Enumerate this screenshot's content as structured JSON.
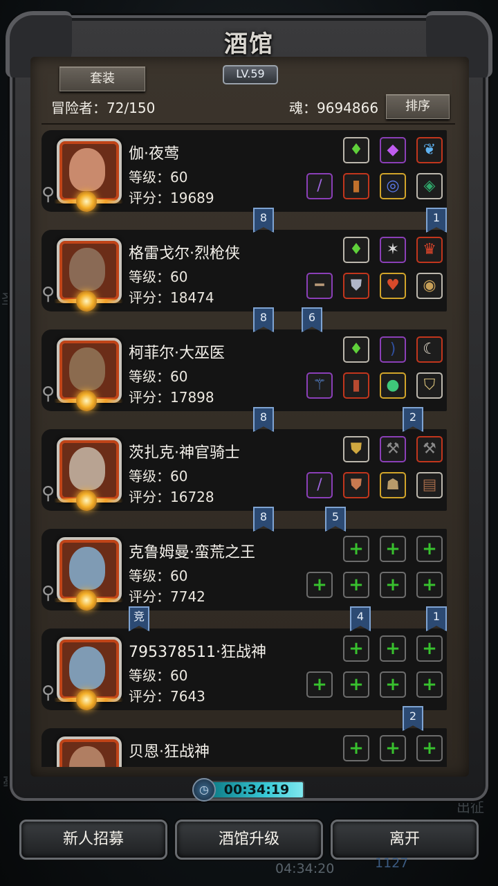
{
  "title": "酒馆",
  "level": "LV.59",
  "suit_button": "套装",
  "sort_button": "排序",
  "adventurers": "冒险者：72/150",
  "soul": "魂：9694866",
  "heroes": [
    {
      "name": "伽·夜莺",
      "level": "等级：60",
      "score": "评分：19689",
      "top": [
        "green-gem-icon",
        "purple-crystal-icon",
        "blue-feather-icon"
      ],
      "bottom": [
        "purple-staff-icon",
        "red-robe-icon",
        "blue-ring-icon",
        "gold-amulet-icon"
      ]
    },
    {
      "name": "格雷戈尔·烈枪侠",
      "level": "等级：60",
      "score": "评分：18474",
      "top": [
        "green-gem-icon",
        "wing-emblem-icon",
        "red-crest-icon"
      ],
      "bottom": [
        "rifle-icon",
        "armor-icon",
        "heart-amulet-icon",
        "round-shield-icon"
      ]
    },
    {
      "name": "柯菲尔·大巫医",
      "level": "等级：60",
      "score": "评分：17898",
      "top": [
        "green-gem-icon",
        "dark-bow-icon",
        "tusk-icon"
      ],
      "bottom": [
        "scepter-icon",
        "red-armor-icon",
        "green-orb-icon",
        "gold-shield-icon"
      ]
    },
    {
      "name": "茨扎克·神官骑士",
      "level": "等级：60",
      "score": "评分：16728",
      "top": [
        "gold-armor-icon",
        "dark-axe-icon",
        "dark-axe-icon"
      ],
      "bottom": [
        "purple-staff-icon",
        "plate-armor-icon",
        "mask-icon",
        "tome-icon"
      ]
    },
    {
      "name": "克鲁姆曼·蛮荒之王",
      "level": "等级：60",
      "score": "评分：7742",
      "top": [
        "empty-slot-icon",
        "empty-slot-icon",
        "empty-slot-icon"
      ],
      "bottom": [
        "empty-slot-icon",
        "empty-slot-icon",
        "empty-slot-icon",
        "empty-slot-icon"
      ]
    },
    {
      "name": "795378511·狂战神",
      "level": "等级：60",
      "score": "评分：7643",
      "top": [
        "empty-slot-icon",
        "empty-slot-icon",
        "empty-slot-icon"
      ],
      "bottom": [
        "empty-slot-icon",
        "empty-slot-icon",
        "empty-slot-icon",
        "empty-slot-icon"
      ]
    },
    {
      "name": "贝恩·狂战神",
      "level": "",
      "score": "",
      "top": [
        "empty-slot-icon",
        "empty-slot-icon",
        "empty-slot-icon"
      ],
      "bottom": []
    }
  ],
  "tags": [
    {
      "row": 0,
      "labels": [
        "8",
        "1"
      ]
    },
    {
      "row": 1,
      "labels": [
        "8",
        "6"
      ]
    },
    {
      "row": 2,
      "labels": [
        "8",
        "2"
      ]
    },
    {
      "row": 3,
      "labels": [
        "8",
        "5"
      ]
    },
    {
      "row": 4,
      "labels": [
        "竞",
        "4",
        "1"
      ]
    },
    {
      "row": 5,
      "labels": [
        "2"
      ]
    }
  ],
  "timer": "00:34:19",
  "buttons": {
    "recruit": "新人招募",
    "upgrade": "酒馆升级",
    "leave": "离开"
  },
  "side_left": "圣",
  "side_left2": "亳",
  "side_right": "出征",
  "ghost_clock": "04:34:20",
  "ghost_num": "1127",
  "colors": {
    "panel": "#3b342c",
    "empty_plus": "#38c12e",
    "tag": "#2c4a73"
  }
}
